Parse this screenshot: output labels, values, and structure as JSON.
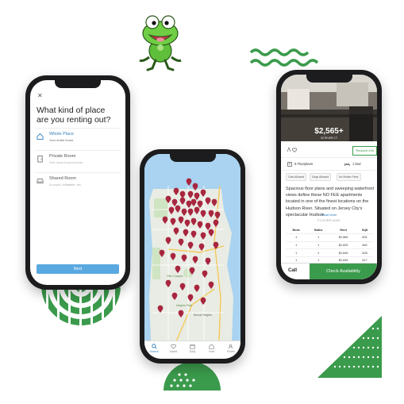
{
  "onboarding": {
    "close_icon": "close-icon",
    "title": "What kind of place are you renting out?",
    "options": [
      {
        "label": "Whole Place",
        "sub": "Your entire home",
        "icon": "house-icon"
      },
      {
        "label": "Private Room",
        "sub": "One room in your home",
        "icon": "door-icon"
      },
      {
        "label": "Shared Room",
        "sub": "A couch, inflatable, etc.",
        "icon": "couch-icon"
      }
    ],
    "next_label": "Next"
  },
  "map_screen": {
    "tabs": [
      {
        "label": "Search",
        "icon": "search-icon"
      },
      {
        "label": "Saved",
        "icon": "heart-icon"
      },
      {
        "label": "Daily",
        "icon": "calendar-icon"
      },
      {
        "label": "Host",
        "icon": "home-icon"
      },
      {
        "label": "Profile",
        "icon": "user-icon"
      }
    ],
    "map_labels": [
      "Heights Park",
      "Glen Canyon",
      "Bernal Heights"
    ]
  },
  "listing": {
    "price": "$2,565+",
    "address": "30 RIVER CT",
    "request_info_label": "Request Info",
    "floorplans_label": "9 Floorplans",
    "beds_label": "1 bed",
    "tags": [
      "Cats Allowed",
      "Dogs Allowed",
      "No Broker Fees"
    ],
    "description": "Spacious floor plans and sweeping waterfront views define these NO FEE apartments located in one of the finest locations on the Hudson River. Situated on Jersey City's spectacular Hudson",
    "read_more": "Read More",
    "floorplans_heading": "FLOORPLANS",
    "table": {
      "headers": [
        "Beds",
        "Baths",
        "Rent",
        "Sqft"
      ],
      "rows": [
        [
          "1",
          "1",
          "$2,565",
          "831"
        ],
        [
          "1",
          "1",
          "$2,625",
          "662"
        ],
        [
          "1",
          "1",
          "$2,645",
          "828"
        ],
        [
          "1",
          "1",
          "$2,645",
          "817"
        ],
        [
          "1",
          "1",
          "$2,650",
          "817"
        ]
      ]
    },
    "call_label": "Call",
    "check_label": "Check Availability"
  },
  "colors": {
    "brand_green": "#3b9b4c",
    "accent_blue": "#2f7fbf",
    "pin_red": "#a8263f"
  }
}
